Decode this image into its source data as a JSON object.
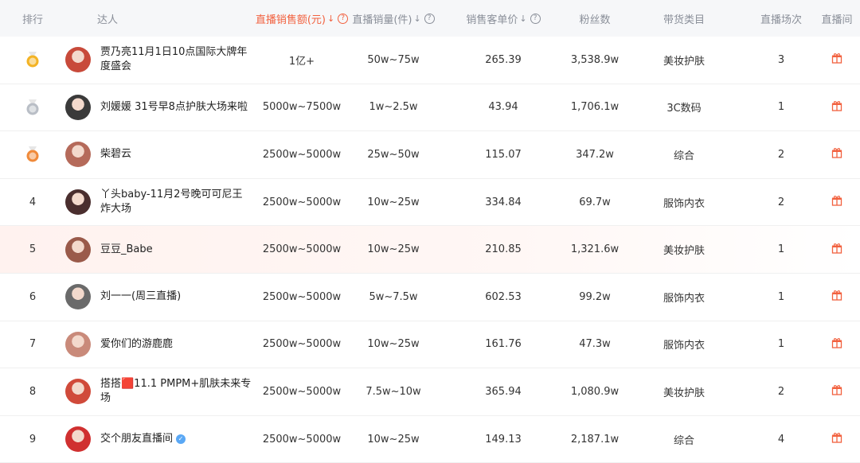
{
  "headers": {
    "rank": "排行",
    "star": "达人",
    "gmv": "直播销售额(元)",
    "qty": "直播销量(件)",
    "price": "销售客单价",
    "fans": "粉丝数",
    "category": "带货类目",
    "times": "直播场次",
    "room": "直播间"
  },
  "colors": {
    "accent": "#f2613f",
    "gold": "#f3b324",
    "silver": "#b9bec6",
    "bronze": "#f08a3a"
  },
  "rows": [
    {
      "rank": "",
      "medal": "gold",
      "name": "贾乃亮11月1日10点国际大牌年度盛会",
      "gmv": "1亿+",
      "qty": "50w~75w",
      "price": "265.39",
      "fans": "3,538.9w",
      "category": "美妆护肤",
      "times": "3"
    },
    {
      "rank": "",
      "medal": "silver",
      "name": "刘媛媛 31号早8点护肤大场来啦",
      "gmv": "5000w~7500w",
      "qty": "1w~2.5w",
      "price": "43.94",
      "fans": "1,706.1w",
      "category": "3C数码",
      "times": "1"
    },
    {
      "rank": "",
      "medal": "bronze",
      "name": "柴碧云",
      "gmv": "2500w~5000w",
      "qty": "25w~50w",
      "price": "115.07",
      "fans": "347.2w",
      "category": "综合",
      "times": "2"
    },
    {
      "rank": "4",
      "medal": "",
      "name": "丫头baby-11月2号晚可可尼王炸大场",
      "gmv": "2500w~5000w",
      "qty": "10w~25w",
      "price": "334.84",
      "fans": "69.7w",
      "category": "服饰内衣",
      "times": "2"
    },
    {
      "rank": "5",
      "medal": "",
      "name": "豆豆_Babe",
      "gmv": "2500w~5000w",
      "qty": "10w~25w",
      "price": "210.85",
      "fans": "1,321.6w",
      "category": "美妆护肤",
      "times": "1"
    },
    {
      "rank": "6",
      "medal": "",
      "name": "刘一一(周三直播)",
      "gmv": "2500w~5000w",
      "qty": "5w~7.5w",
      "price": "602.53",
      "fans": "99.2w",
      "category": "服饰内衣",
      "times": "1"
    },
    {
      "rank": "7",
      "medal": "",
      "name": "爱你们的游鹿鹿",
      "gmv": "2500w~5000w",
      "qty": "10w~25w",
      "price": "161.76",
      "fans": "47.3w",
      "category": "服饰内衣",
      "times": "1"
    },
    {
      "rank": "8",
      "medal": "",
      "name": "搭搭🟥11.1 PMPM+肌肤未来专场",
      "gmv": "2500w~5000w",
      "qty": "7.5w~10w",
      "price": "365.94",
      "fans": "1,080.9w",
      "category": "美妆护肤",
      "times": "2"
    },
    {
      "rank": "9",
      "medal": "",
      "name": "交个朋友直播间",
      "verified": true,
      "gmv": "2500w~5000w",
      "qty": "10w~25w",
      "price": "149.13",
      "fans": "2,187.1w",
      "category": "综合",
      "times": "4"
    }
  ]
}
